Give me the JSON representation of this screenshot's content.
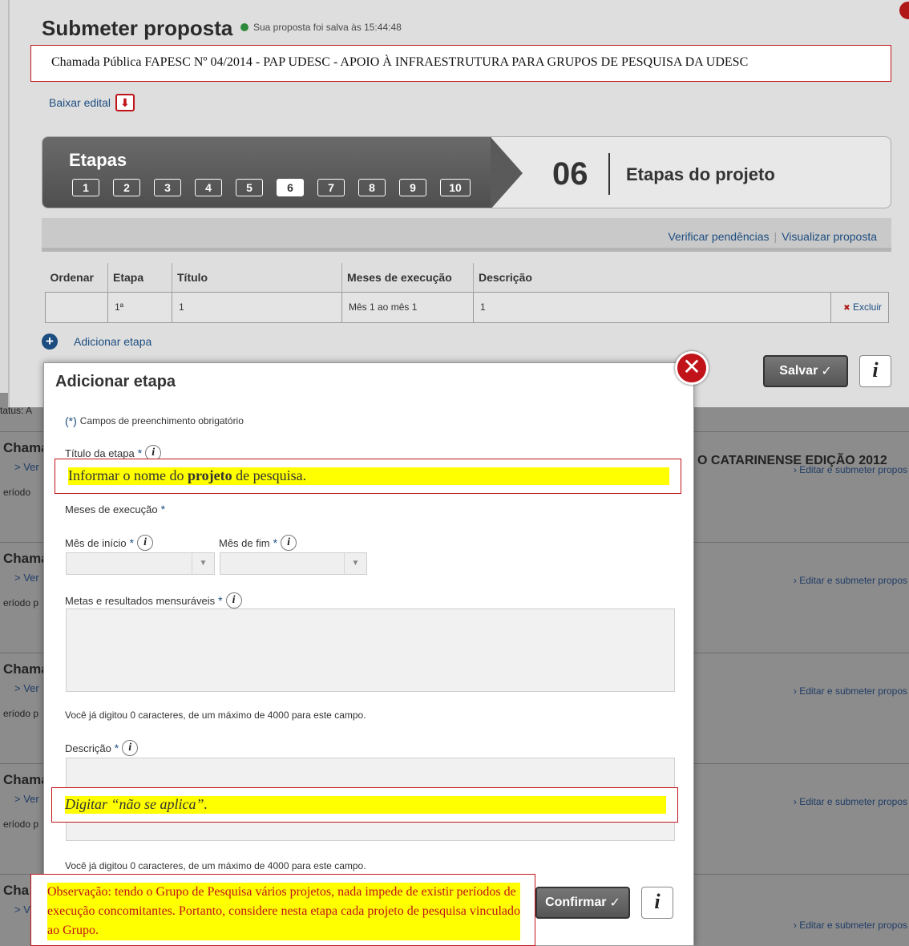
{
  "header": {
    "title": "Submeter proposta",
    "saved_status": "Sua proposta foi salva às 15:44:48"
  },
  "chamada": "Chamada Pública FAPESC Nº 04/2014 - PAP UDESC - APOIO À INFRAESTRUTURA PARA GRUPOS DE PESQUISA DA UDESC",
  "baixar_edital": "Baixar edital",
  "steps": {
    "label": "Etapas",
    "items": [
      "1",
      "2",
      "3",
      "4",
      "5",
      "6",
      "7",
      "8",
      "9",
      "10"
    ],
    "active": "6",
    "current_number": "06",
    "current_title": "Etapas do projeto"
  },
  "toolbar": {
    "verificar": "Verificar pendências",
    "visualizar": "Visualizar proposta"
  },
  "table": {
    "headers": [
      "Ordenar",
      "Etapa",
      "Título",
      "Meses de execução",
      "Descrição"
    ],
    "rows": [
      {
        "ordenar": "",
        "etapa": "1ª",
        "titulo": "1",
        "meses": "Mês 1 ao mês 1",
        "descricao": "1",
        "action": "Excluir"
      }
    ]
  },
  "add_etapa": "Adicionar etapa",
  "salvar": "Salvar",
  "modal": {
    "title": "Adicionar etapa",
    "required_note": "Campos de preenchimento obrigatório",
    "required_mark": "(*)",
    "titulo_label": "Título da etapa",
    "meses_label": "Meses de execução",
    "mes_inicio_label": "Mês de início",
    "mes_fim_label": "Mês de fim",
    "metas_label": "Metas e resultados mensuráveis",
    "counter_1": "Você já digitou 0 caracteres, de um máximo de 4000 para este campo.",
    "descricao_label": "Descrição",
    "counter_2": "Você já digitou 0 caracteres, de um máximo de 4000 para este campo.",
    "confirmar": "Confirmar"
  },
  "callouts": {
    "titulo_pre": "Informar o nome do ",
    "titulo_bold": "projeto",
    "titulo_post": " de pesquisa.",
    "descricao": "Digitar “não se aplica”.",
    "observacao": "Observação: tendo o Grupo de Pesquisa vários projetos, nada impede de existir períodos de execução concomitantes. Portanto, considere nesta etapa cada projeto de pesquisa vinculado ao Grupo."
  },
  "background_list": {
    "status_prefix": "tatus: A",
    "catarinense": "O CATARINENSE EDIÇÃO 2012",
    "rows": [
      {
        "title": "Chama",
        "ver": "> Ver",
        "periodo": "eríodo",
        "editar": "› Editar e submeter propos"
      },
      {
        "title": "Chama",
        "ver": "> Ver",
        "periodo": "eríodo p",
        "editar": "› Editar e submeter propos"
      },
      {
        "title": "Chama",
        "ver": "> Ver",
        "periodo": "eríodo p",
        "editar": "› Editar e submeter propos"
      },
      {
        "title": "Chama",
        "ver": "> Ver",
        "periodo": "eríodo p",
        "editar": "› Editar e submeter propos"
      },
      {
        "title": "Cha",
        "ver": "> V",
        "periodo": "",
        "editar": "› Editar e submeter propos"
      }
    ]
  },
  "colors": {
    "link": "#1d4d80",
    "callout_border": "#c0141a",
    "highlight": "#ffff00",
    "saved_dot": "#2e8a3a"
  }
}
